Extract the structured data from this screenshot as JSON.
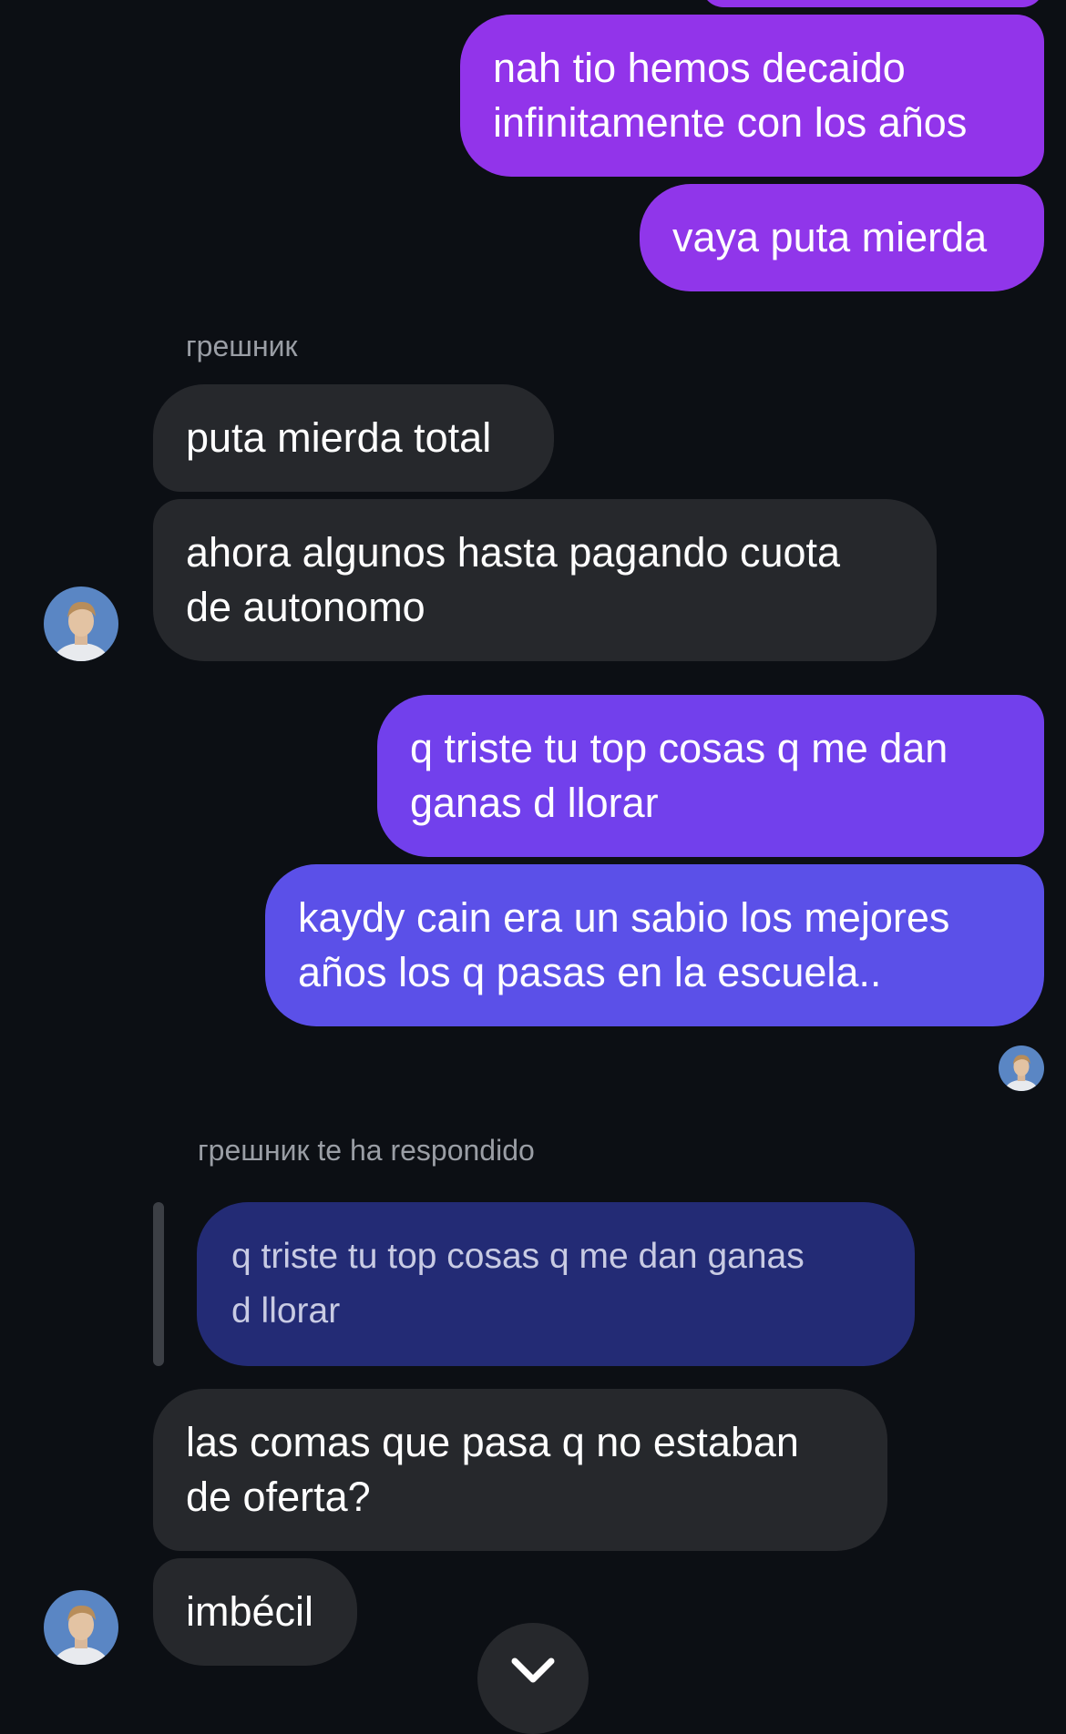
{
  "messages": {
    "m1": "nah tio hemos decaido\ninfinitamente con los años",
    "m2": "vaya puta mierda",
    "sender_name": "грешник",
    "m3": "puta mierda total",
    "m4": "ahora algunos hasta pagando cuota\nde autonomo",
    "m5": "q triste tu top cosas q me dan\nganas d llorar",
    "m6": "kaydy cain era un sabio los mejores\naños los q pasas en la escuela..",
    "reply_header": "грешник te ha respondido",
    "reply_quote": "q triste tu top cosas q me dan ganas\nd llorar",
    "m7": "las comas que pasa q no estaban\nde oferta?",
    "m8": "imbécil"
  },
  "colors": {
    "background": "#0c0f14",
    "outgoing_purple": "#9234ea",
    "outgoing_violet": "#7240ec",
    "outgoing_indigo": "#5b50e8",
    "incoming": "#26282c",
    "reply_quote_bg": "#232b75"
  },
  "icons": {
    "scroll_down": "chevron-down-icon"
  }
}
